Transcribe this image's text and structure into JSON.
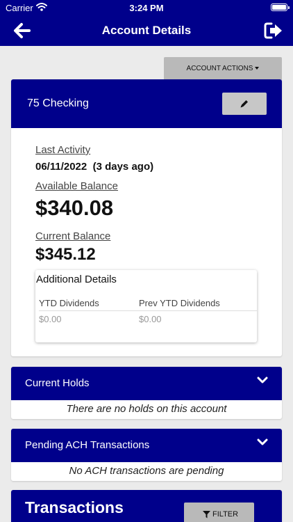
{
  "status_bar": {
    "carrier": "Carrier",
    "time": "3:24 PM"
  },
  "nav": {
    "title": "Account Details",
    "back_icon": "arrow-left-icon",
    "logout_icon": "sign-out-icon"
  },
  "account_actions": {
    "label": "ACCOUNT ACTIONS"
  },
  "account": {
    "name": "75 Checking",
    "last_activity_label": "Last Activity",
    "last_activity_value": "06/11/2022  (3 days ago)",
    "available_balance_label": "Available Balance",
    "available_balance_value": "$340.08",
    "current_balance_label": "Current Balance",
    "current_balance_value": "$345.12"
  },
  "additional_details": {
    "title": "Additional Details",
    "columns": [
      {
        "header": "YTD Dividends",
        "value": "$0.00"
      },
      {
        "header": "Prev YTD Dividends",
        "value": "$0.00"
      }
    ]
  },
  "holds": {
    "title": "Current Holds",
    "empty_text": "There are no holds on this account"
  },
  "ach": {
    "title": "Pending ACH Transactions",
    "empty_text": "No ACH transactions are pending"
  },
  "transactions": {
    "title": "Transactions",
    "filter_label": "FILTER"
  },
  "colors": {
    "primary": "#00008b",
    "button_gray": "#b9b9b9",
    "background": "#ebebeb"
  }
}
